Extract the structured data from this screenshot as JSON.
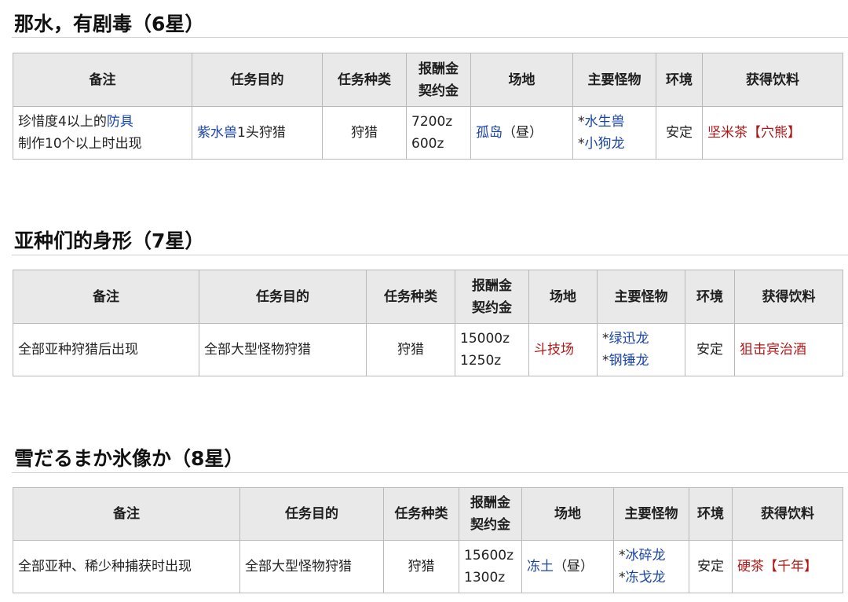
{
  "headers": {
    "note": "备注",
    "objective": "任务目的",
    "type": "任务种类",
    "reward": "报酬金",
    "fee": "契约金",
    "location": "场地",
    "monsters": "主要怪物",
    "env": "环境",
    "drink": "获得饮料"
  },
  "quests": [
    {
      "title": "那水，有剧毒（6星）",
      "note": {
        "line1_before": "珍惜度4以上的",
        "line1_link": "防具",
        "line2": "制作10个以上时出现"
      },
      "objective": {
        "link": "紫水兽",
        "rest": "1头狩猎"
      },
      "type": "狩猎",
      "reward": "7200z",
      "fee": "600z",
      "location": {
        "link": "孤岛",
        "suffix": "（昼）"
      },
      "monsters": [
        "水生兽",
        "小狗龙"
      ],
      "monster_prefix": "*",
      "env": "安定",
      "drink": "坚米茶【穴熊】"
    },
    {
      "title": "亚种们的身形（7星）",
      "note": {
        "line1": "全部亚种狩猎后出现"
      },
      "objective": {
        "text": "全部大型怪物狩猎"
      },
      "type": "狩猎",
      "reward": "15000z",
      "fee": "1250z",
      "location": {
        "link": "斗技场"
      },
      "monsters": [
        "绿迅龙",
        "钢锤龙"
      ],
      "monster_prefix": "*",
      "env": "安定",
      "drink": "狙击宾治酒"
    },
    {
      "title": "雪だるまか氷像か（8星）",
      "note": {
        "line1": "全部亚种、稀少种捕获时出现"
      },
      "objective": {
        "text": "全部大型怪物狩猎"
      },
      "type": "狩猎",
      "reward": "15600z",
      "fee": "1300z",
      "location": {
        "link": "冻土",
        "suffix": "（昼）"
      },
      "monsters": [
        "冰碎龙",
        "冻戈龙"
      ],
      "monster_prefix": "*",
      "env": "安定",
      "drink": "硬茶【千年】"
    }
  ],
  "colors": {
    "link_blue": "#1a44a8",
    "link_red": "#b01818",
    "header_bg": "#e9e9e9",
    "border": "#b9b9b9"
  }
}
